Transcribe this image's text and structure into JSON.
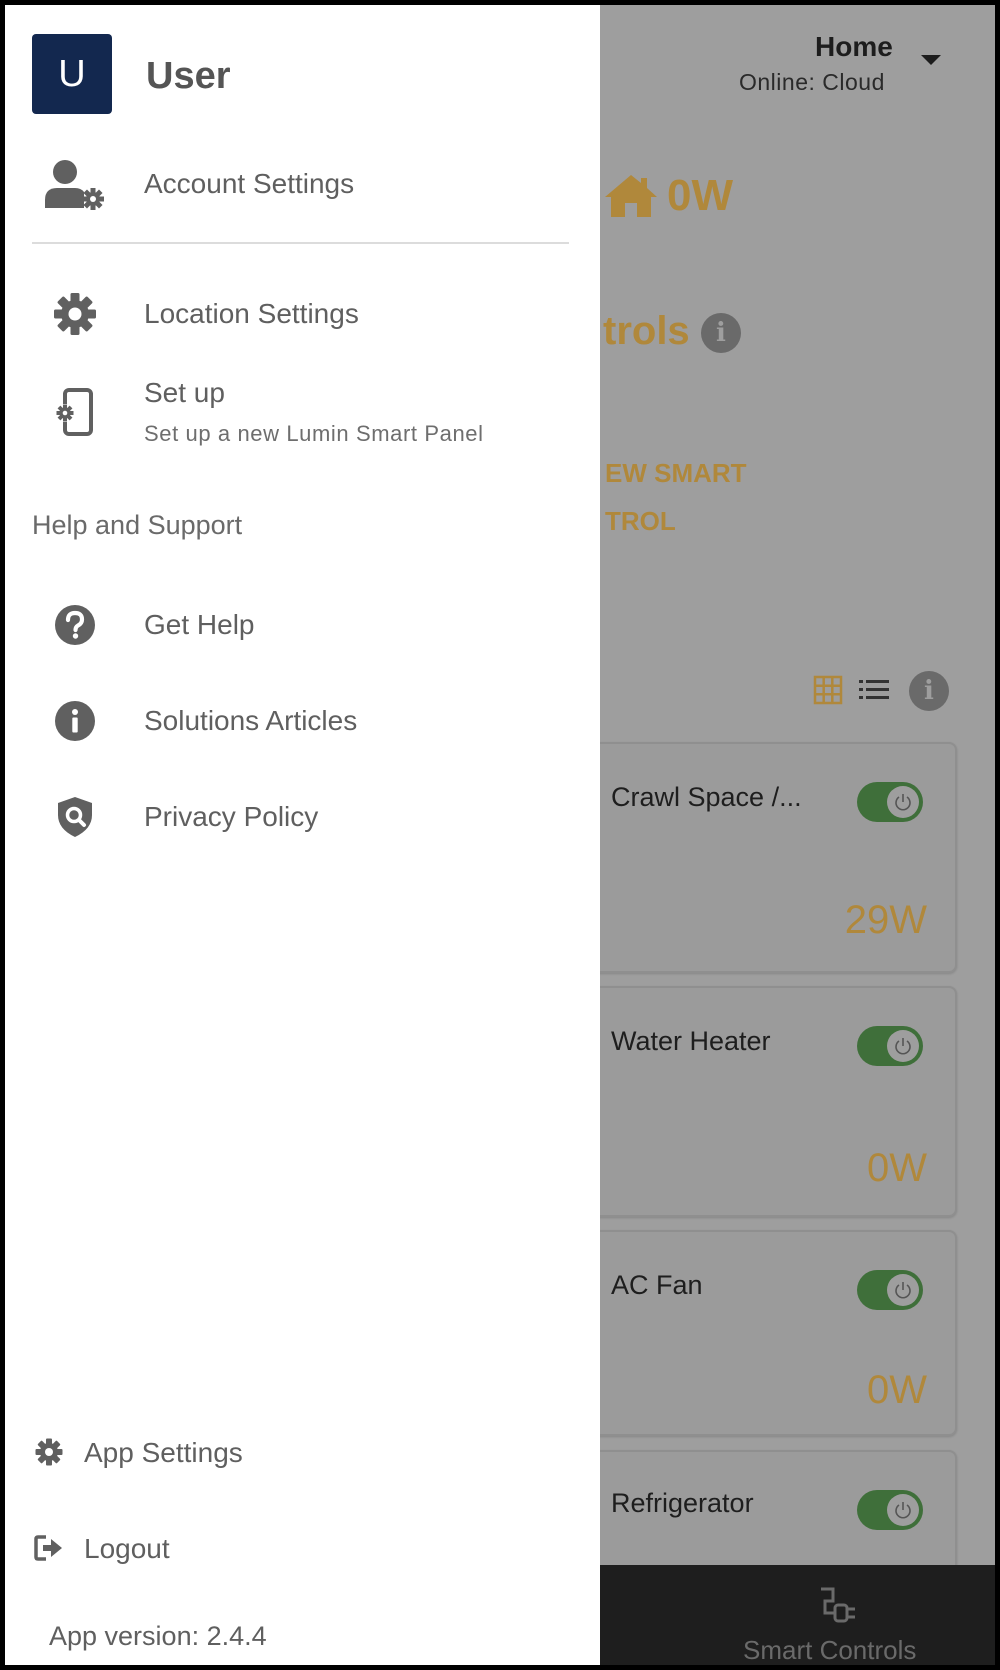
{
  "background": {
    "location": {
      "name": "Home",
      "status": "Online: Cloud"
    },
    "home_power": "0W",
    "controls_title": "trols",
    "add_control_lines": [
      "EW SMART",
      "TROL"
    ],
    "devices": [
      {
        "name": "Crawl Space /...",
        "power": "29W",
        "on": true
      },
      {
        "name": "Water Heater",
        "power": "0W",
        "on": true
      },
      {
        "name": "AC Fan",
        "power": "0W",
        "on": true
      },
      {
        "name": "Refrigerator",
        "power": "",
        "on": true
      }
    ],
    "bottom_nav": {
      "smart_controls": "Smart Controls"
    },
    "accent_color": "#b0883b",
    "toggle_color": "#3f6f3a"
  },
  "drawer": {
    "avatar_letter": "U",
    "user_name": "User",
    "items": {
      "account_settings": {
        "label": "Account Settings",
        "icon": "user-gear-icon"
      },
      "location_settings": {
        "label": "Location Settings",
        "icon": "gear-icon"
      },
      "setup": {
        "label": "Set up",
        "subtitle": "Set up a new Lumin Smart Panel",
        "icon": "phone-gear-icon"
      }
    },
    "help_header": "Help and Support",
    "help_items": {
      "get_help": {
        "label": "Get Help",
        "icon": "question-circle-icon"
      },
      "solutions": {
        "label": "Solutions Articles",
        "icon": "info-circle-icon"
      },
      "privacy": {
        "label": "Privacy Policy",
        "icon": "shield-search-icon"
      }
    },
    "bottom": {
      "app_settings": {
        "label": "App Settings",
        "icon": "gear-icon"
      },
      "logout": {
        "label": "Logout",
        "icon": "logout-icon"
      }
    },
    "app_version": "App version: 2.4.4",
    "avatar_color": "#13284f"
  }
}
